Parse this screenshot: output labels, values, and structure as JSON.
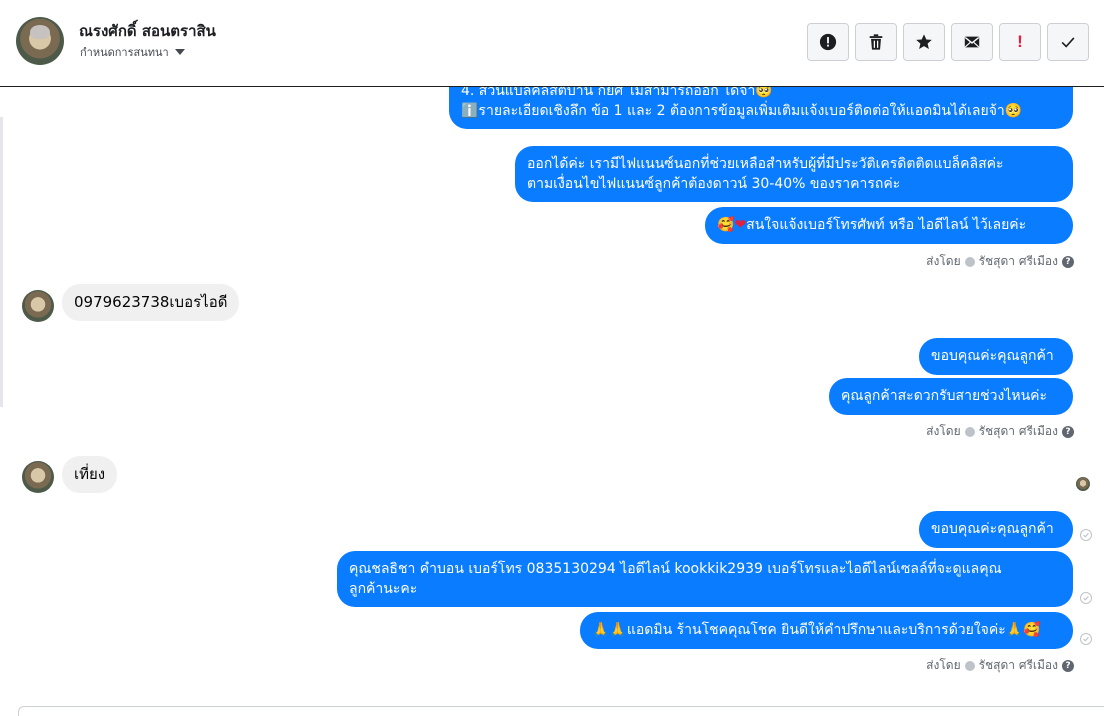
{
  "header": {
    "contact_name": "ณรงศักดิ์ สอนตราสิน",
    "conversation_label": "กำหนดการสนทนา",
    "actions": [
      {
        "name": "spam",
        "icon": "alert-circle-icon"
      },
      {
        "name": "delete",
        "icon": "trash-icon"
      },
      {
        "name": "star",
        "icon": "star-icon"
      },
      {
        "name": "mark-unread",
        "icon": "envelope-icon"
      },
      {
        "name": "important",
        "icon": "exclamation-icon"
      },
      {
        "name": "done",
        "icon": "checkmark-icon"
      }
    ]
  },
  "messages": {
    "m1_line1": "4. ส่วนแบล็คลิสต์บาน กยศ ไม่สามารถออก ได้จ้า🥺",
    "m1_line2": "ℹ️รายละเอียดเชิงลึก ข้อ 1 และ 2 ต้องการข้อมูลเพิ่มเติมแจ้งเบอร์ติดต่อให้แอดมินได้เลยจ้า🥺",
    "m2_line1": "ออกได้ค่ะ เรามีไฟแนนซ์นอกที่ช่วยเหลือสำหรับผู้ที่มีประวัติเครดิตติดแบล็คลิสค่ะ",
    "m2_line2": "ตามเงื่อนไขไฟแนนซ์ลูกค้าต้องดาวน์ 30-40% ของราคารถค่ะ",
    "m3_text": "สนใจแจ้งเบอร์โทรศัพท์ หรือ ไอดีไลน์  ไว้เลยค่ะ",
    "m3_emoji_a": "🥰",
    "m3_emoji_b": "❤",
    "sent_by_1": "ส่งโดย",
    "agent_name_1": "รัชสุดา ศรีเมือง",
    "in1": "0979623738เบอรไอดี",
    "m4": "ขอบคุณค่ะคุณลูกค้า",
    "m5": "คุณลูกค้าสะดวกรับสายช่วงไหนค่ะ",
    "sent_by_2": "ส่งโดย",
    "agent_name_2": "รัชสุดา ศรีเมือง",
    "in2": "เที่ยง",
    "m6": "ขอบคุณค่ะคุณลูกค้า",
    "m7_line1": "คุณชลธิชา คำบอน เบอร์โทร 0835130294  ไอดีไลน์ kookkik2939   เบอร์โทรและไอดีไลน์เซลล์ที่จะดูแลคุณ",
    "m7_line2": "ลูกค้านะคะ",
    "m8_prefix": "🙏🙏",
    "m8_text": "แอดมิน ร้านโชคคุณโชค ยินดีให้คำปรึกษาและบริการด้วยใจค่ะ",
    "m8_suffix": "🙏🥰",
    "sent_by_3": "ส่งโดย",
    "agent_name_3": "รัชสุดา ศรีเมือง"
  },
  "colors": {
    "outgoing_bubble": "#0a7cff",
    "incoming_bubble": "#f0f0f0",
    "meta_text": "#606770"
  }
}
